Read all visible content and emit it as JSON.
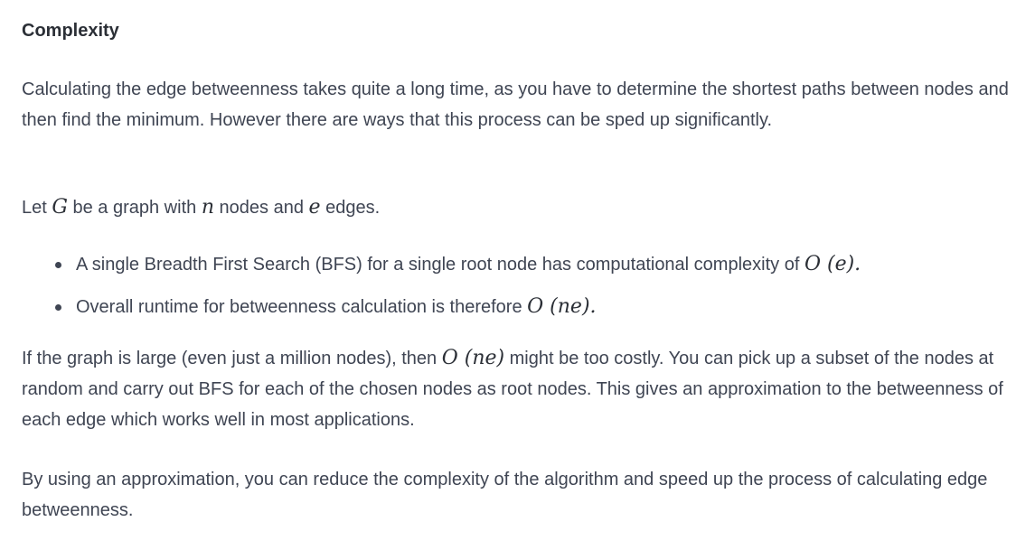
{
  "heading": "Complexity",
  "paragraph1": "Calculating the edge betweenness takes quite a long time, as you have to determine the shortest paths between nodes and then find the minimum. However there are ways that this process can be sped up significantly.",
  "paragraph2": {
    "t1": "Let ",
    "m1": "G",
    "t2": " be a graph with ",
    "m2": "n",
    "t3": " nodes and ",
    "m3": "e",
    "t4": " edges."
  },
  "bullets": [
    {
      "text": "A single Breadth First Search (BFS)  for a single root node has computational complexity of ",
      "math": "O (e)."
    },
    {
      "text": "Overall runtime for betweenness calculation is therefore ",
      "math": "O (ne)."
    }
  ],
  "paragraph3": {
    "t1": "If the graph is large (even just a million nodes), then ",
    "m1": "O (ne)",
    "t2": " might be too costly. You can pick up a subset of the nodes at random and carry out BFS for each of the chosen nodes as root nodes. This gives an approximation to the betweenness of each edge which works well in most applications."
  },
  "paragraph4": "By using an approximation, you can reduce the complexity of the algorithm and speed up the process of calculating edge betweenness."
}
